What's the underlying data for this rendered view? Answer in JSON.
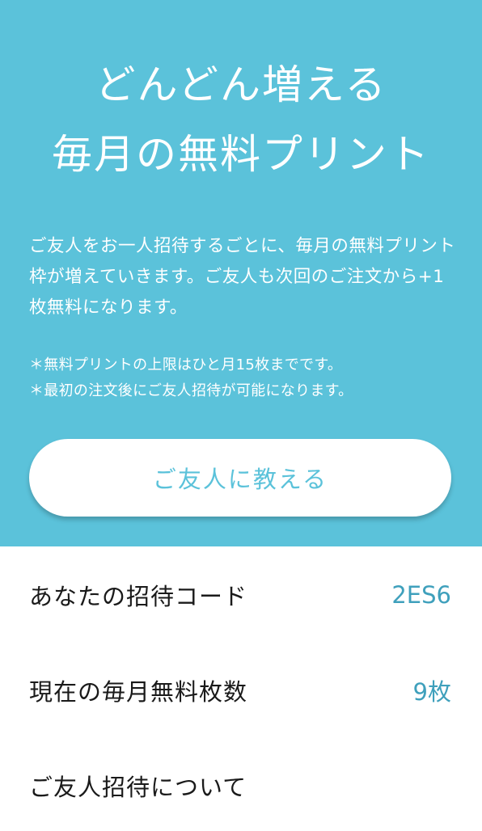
{
  "hero": {
    "title_line1": "どんどん増える",
    "title_line2": "毎月の無料プリント",
    "description": "ご友人をお一人招待するごとに、毎月の無料プリント枠が増えていきます。ご友人も次回のご注文から+1枚無料になります。",
    "note1": "＊無料プリントの上限はひと月15枚までです。",
    "note2": "＊最初の注文後にご友人招待が可能になります。",
    "invite_button_label": "ご友人に教える",
    "background_color": "#5bc2da"
  },
  "info": {
    "invite_code_label": "あなたの招待コード",
    "invite_code_value": "2ES6",
    "free_count_label": "現在の毎月無料枚数",
    "free_count_value": "9枚",
    "about_label": "ご友人招待について",
    "accent_color": "#3fa0bc"
  }
}
